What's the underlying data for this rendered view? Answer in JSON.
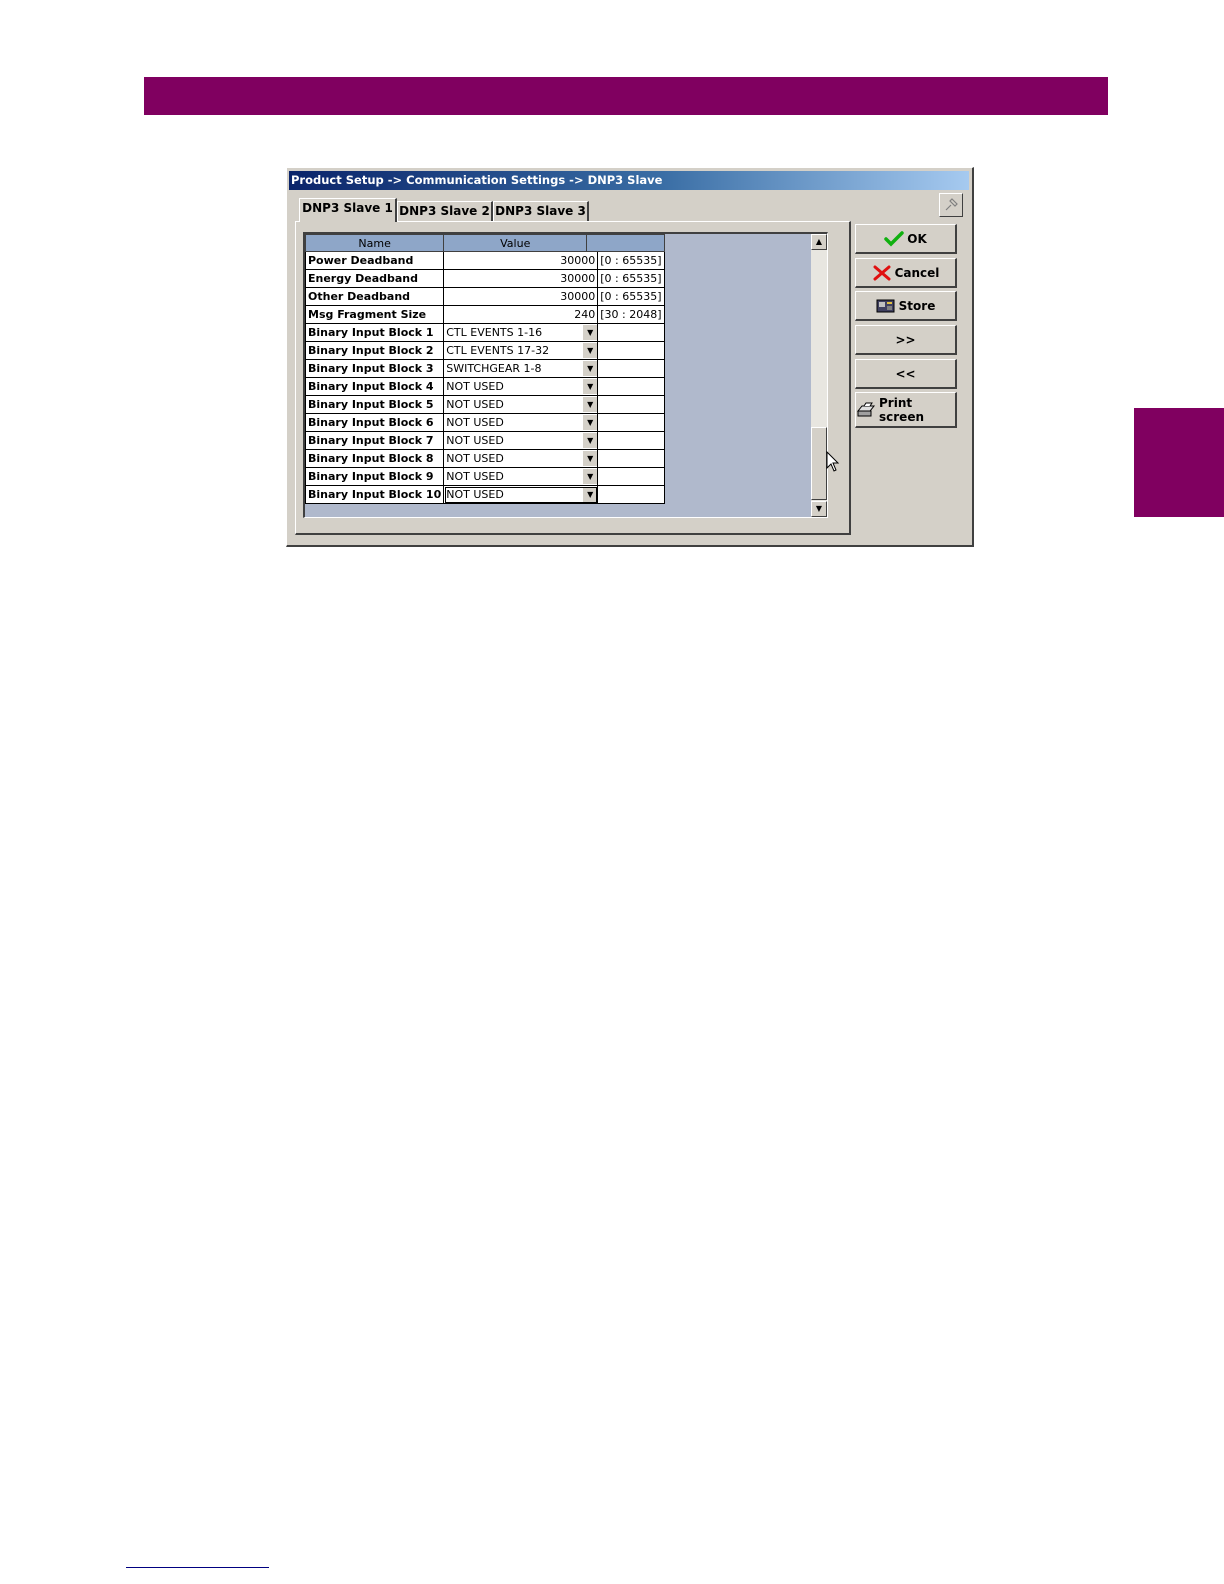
{
  "window": {
    "title": "Product Setup -> Communication Settings -> DNP3 Slave"
  },
  "tabs": [
    {
      "label": "DNP3 Slave 1",
      "active": true
    },
    {
      "label": "DNP3 Slave 2",
      "active": false
    },
    {
      "label": "DNP3 Slave 3",
      "active": false
    }
  ],
  "grid": {
    "headers": {
      "name": "Name",
      "value": "Value",
      "range": ""
    },
    "rows": [
      {
        "name": "Power Deadband",
        "value": "30000",
        "range": "[0 : 65535]"
      },
      {
        "name": "Energy Deadband",
        "value": "30000",
        "range": "[0 : 65535]"
      },
      {
        "name": "Other Deadband",
        "value": "30000",
        "range": "[0 : 65535]"
      },
      {
        "name": "Msg Fragment Size",
        "value": "240",
        "range": "[30 : 2048]"
      },
      {
        "name": "Binary Input Block 1",
        "value": "CTL EVENTS 1-16",
        "range": ""
      },
      {
        "name": "Binary Input Block 2",
        "value": "CTL EVENTS 17-32",
        "range": ""
      },
      {
        "name": "Binary Input Block 3",
        "value": "SWITCHGEAR 1-8",
        "range": ""
      },
      {
        "name": "Binary Input Block 4",
        "value": "NOT USED",
        "range": ""
      },
      {
        "name": "Binary Input Block 5",
        "value": "NOT USED",
        "range": ""
      },
      {
        "name": "Binary Input Block 6",
        "value": "NOT USED",
        "range": ""
      },
      {
        "name": "Binary Input Block 7",
        "value": "NOT USED",
        "range": ""
      },
      {
        "name": "Binary Input Block 8",
        "value": "NOT USED",
        "range": ""
      },
      {
        "name": "Binary Input Block 9",
        "value": "NOT USED",
        "range": ""
      },
      {
        "name": "Binary Input Block 10",
        "value": "NOT USED",
        "range": ""
      }
    ]
  },
  "buttons": {
    "ok": "OK",
    "cancel": "Cancel",
    "store": "Store",
    "next": ">>",
    "prev": "<<",
    "print": "Print screen"
  },
  "colors": {
    "page_accent": "#800060",
    "grid_background": "#b0b9cc",
    "header_cell": "#8ea6c8",
    "dialog_face": "#d4d0c8"
  }
}
